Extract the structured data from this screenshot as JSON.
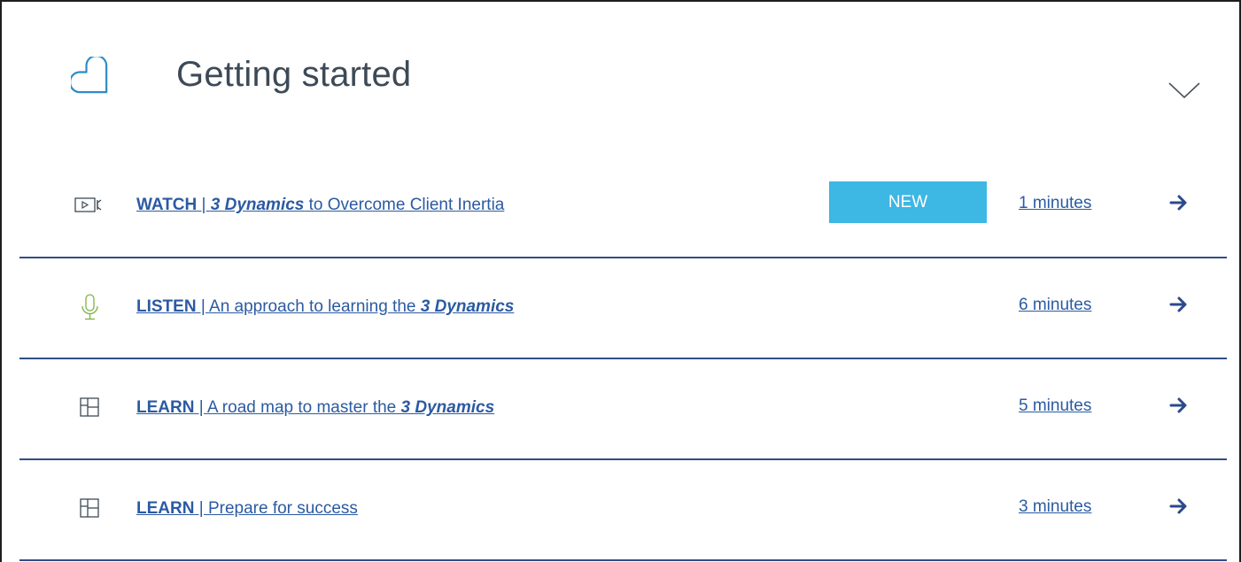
{
  "header": {
    "title": "Getting started",
    "icon": "heart-outline-icon",
    "toggle_icon": "chevron-down-icon"
  },
  "colors": {
    "link": "#2b5aa2",
    "badge_bg": "#3db7e4",
    "divider": "#2f4e86",
    "mic_icon": "#7cb342"
  },
  "items": [
    {
      "icon": "video-play-icon",
      "type_label": "WATCH",
      "separator": " | ",
      "title_pre": "",
      "title_em": "3 Dynamics",
      "title_post": " to Overcome Client Inertia",
      "badge": "NEW",
      "duration": "1 minutes"
    },
    {
      "icon": "microphone-icon",
      "type_label": "LISTEN",
      "separator": " | ",
      "title_pre": "An approach to learning the ",
      "title_em": "3 Dynamics",
      "title_post": "",
      "duration": "6 minutes"
    },
    {
      "icon": "layout-grid-icon",
      "type_label": "LEARN",
      "separator": " | ",
      "title_pre": "A road map to master the ",
      "title_em": "3 Dynamics",
      "title_post": "",
      "duration": "5 minutes"
    },
    {
      "icon": "layout-grid-icon",
      "type_label": "LEARN",
      "separator": " | ",
      "title_pre": "Prepare for success",
      "title_em": "",
      "title_post": "",
      "duration": "3 minutes"
    }
  ]
}
